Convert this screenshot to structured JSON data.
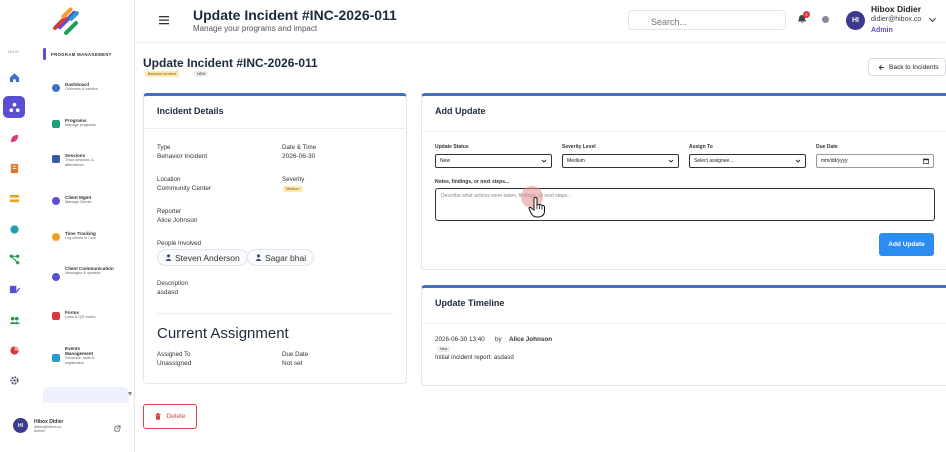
{
  "sidebar": {
    "section_mini": "MAIN",
    "section_title": "PROGRAM MANAGEMENT",
    "items": [
      {
        "name": "Dashboard",
        "sub": "Overview & metrics",
        "icon": "dashboard-icon",
        "color": "#3f6fc8"
      },
      {
        "name": "Programs",
        "sub": "Manage programs",
        "icon": "programs-icon",
        "color": "#1f9e7a"
      },
      {
        "name": "Sessions",
        "sub": "Track sessions & attendance",
        "icon": "sessions-icon",
        "color": "#3c5aa8"
      },
      {
        "name": "Client Mgmt",
        "sub": "Manage Clients",
        "icon": "client-mgmt-icon",
        "color": "#5a4fd0"
      },
      {
        "name": "Time Tracking",
        "sub": "Log clients in / out",
        "icon": "time-tracking-icon",
        "color": "#f0a020"
      },
      {
        "name": "Client Communication",
        "sub": "Messages & updates",
        "icon": "communication-icon",
        "color": "#5a4fd0"
      },
      {
        "name": "Forms",
        "sub": "Links & QR codes",
        "icon": "forms-icon",
        "color": "#d63b3b"
      },
      {
        "name": "Events Management",
        "sub": "Schedule, slots & registration",
        "icon": "events-icon",
        "color": "#2a9ad0"
      }
    ],
    "profile": {
      "initials": "HI",
      "name": "Hibox Didier",
      "email": "didier@hibox.co",
      "role": "Admin"
    }
  },
  "header": {
    "title": "Update Incident #INC-2026-011",
    "subtitle": "Manage your programs and impact",
    "search_placeholder": "Search...",
    "notification_count": "2",
    "user": {
      "initials": "HI",
      "name": "Hibox Didier",
      "email": "didier@hibox.co",
      "role": "Admin"
    }
  },
  "page": {
    "title": "Update Incident #INC-2026-011",
    "type_tag": "Behavior Incident",
    "status_tag": "NEW",
    "back_label": "Back to Incidents",
    "delete_label": "Delete"
  },
  "details": {
    "title": "Incident Details",
    "type_label": "Type",
    "type_value": "Behavior Incident",
    "datetime_label": "Date & Time",
    "datetime_value": "2026-06-30",
    "location_label": "Location",
    "location_value": "Community Center",
    "severity_label": "Severity",
    "severity_value": "Medium",
    "reporter_label": "Reporter",
    "reporter_value": "Alice Johnson",
    "people_label": "People Involved",
    "people": [
      "Steven Anderson",
      "Sagar bhai"
    ],
    "description_label": "Description",
    "description_value": "asdasd",
    "assignment_title": "Current Assignment",
    "assigned_label": "Assigned To",
    "assigned_value": "Unassigned",
    "due_label": "Due Date",
    "due_value": "Not set"
  },
  "add_update": {
    "title": "Add Update",
    "status_label": "Update Status",
    "status_value": "New",
    "severity_label": "Severity Level",
    "severity_value": "Medium",
    "assign_label": "Assign To",
    "assign_value": "Select assignee...",
    "due_label": "Due Date",
    "due_placeholder": "mm/dd/yyyy",
    "notes_label": "Notes, findings, or next steps...",
    "notes_placeholder": "Describe what actions were taken, findings, or next steps...",
    "submit_label": "Add Update"
  },
  "timeline": {
    "title": "Update Timeline",
    "entries": [
      {
        "datetime": "2026-06-30 13:40",
        "by": "by",
        "author": "Alice Johnson",
        "tag": "New",
        "text": "Initial incident report: asdasd"
      }
    ]
  },
  "colors": {
    "accent": "#5a4fd0",
    "primary": "#2c8cf0",
    "danger": "#d64545",
    "card_top": "#3f6fc8"
  }
}
